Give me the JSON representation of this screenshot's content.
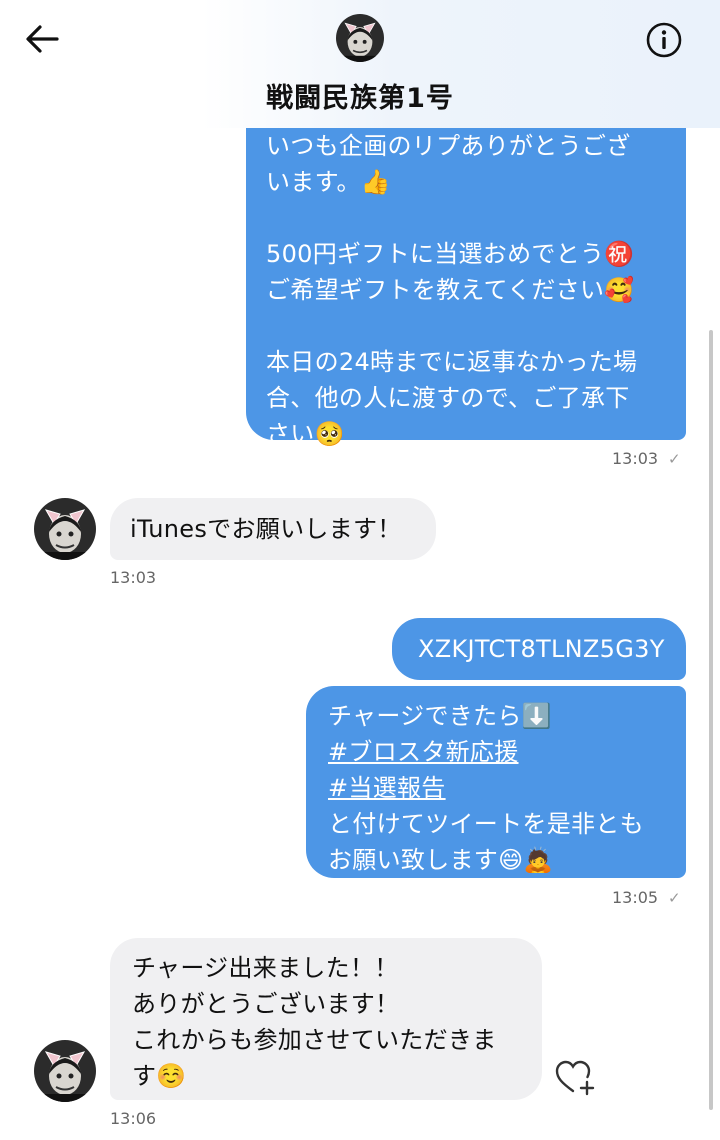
{
  "header": {
    "title": "戦闘民族第1号",
    "back_icon": "arrow-left-icon",
    "info_icon": "info-circle-icon"
  },
  "messages": [
    {
      "direction": "outgoing",
      "text": "いつも企画のリプありがとうござ\nいます。👍\n\n500円ギフトに当選おめでとう㊗️\nご希望ギフトを教えてください🥰\n\n本日の24時までに返事なかった場\n合、他の人に渡すので、ご了承下\nさい🥺",
      "time": "13:03",
      "status": "✓"
    },
    {
      "direction": "incoming",
      "text": "iTunesでお願いします！",
      "time": "13:03"
    },
    {
      "direction": "outgoing",
      "text": "XZKJTCT8TLNZ5G3Y"
    },
    {
      "direction": "outgoing",
      "text_line1": "チャージできたら⬇️",
      "hashtag1": "#ブロスタ新応援",
      "hashtag2": "#当選報告",
      "text_line4": "と付けてツイートを是非とも",
      "text_line5": "お願い致します😄🙇",
      "time": "13:05",
      "status": "✓"
    },
    {
      "direction": "incoming",
      "text": "チャージ出来ました！！\nありがとうございます！\nこれからも参加させていただきま\nす☺️",
      "time": "13:06",
      "reaction_icon": "heart-plus-icon"
    }
  ],
  "colors": {
    "outgoing_bubble": "#4d96e6",
    "incoming_bubble": "#f0f0f2",
    "timestamp": "#666666"
  }
}
